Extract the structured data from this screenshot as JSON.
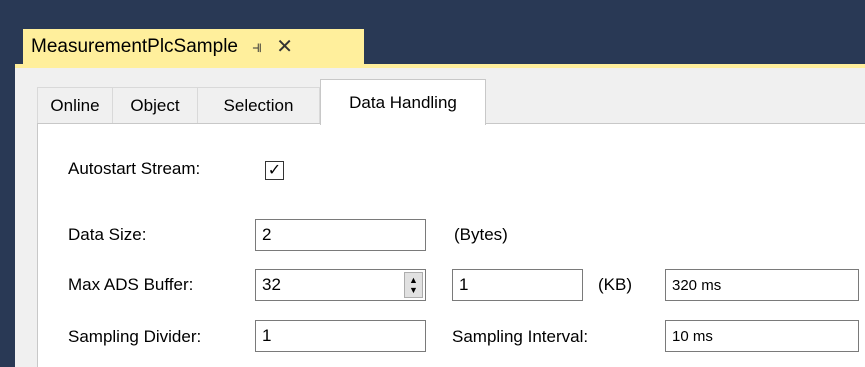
{
  "document": {
    "title": "MeasurementPlcSample",
    "pin_icon": "pin-icon",
    "close_icon": "close-icon"
  },
  "tabs": [
    {
      "label": "Online"
    },
    {
      "label": "Object"
    },
    {
      "label": "Selection"
    },
    {
      "label": "Data Handling"
    }
  ],
  "form": {
    "autostart_label": "Autostart Stream:",
    "autostart_checked": true,
    "data_size_label": "Data Size:",
    "data_size_value": "2",
    "data_size_unit": "(Bytes)",
    "max_ads_label": "Max ADS Buffer:",
    "max_ads_value": "32",
    "buffer_value": "1",
    "buffer_unit": "(KB)",
    "buffer_time": "320 ms",
    "sampling_divider_label": "Sampling Divider:",
    "sampling_divider_value": "1",
    "sampling_interval_label": "Sampling Interval:",
    "sampling_interval_value": "10 ms"
  }
}
